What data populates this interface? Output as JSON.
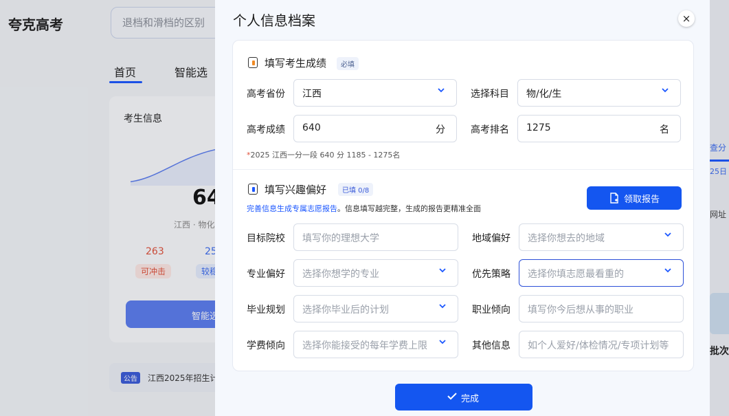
{
  "background": {
    "logo": "夸克高考",
    "search_text": "退档和滑档的区别",
    "tabs": [
      "首页",
      "智能选"
    ],
    "card_title": "考生信息",
    "score": "64",
    "province": "江西 · 物化",
    "counts": [
      "263",
      "25"
    ],
    "badges": [
      "可冲击",
      "较稳"
    ],
    "button": "智能选",
    "notice_tag": "公告",
    "notice_text": "江西2025年招生计",
    "right_tab": "查分",
    "right_year": "25日",
    "right_link": "网址",
    "right_bottom": "批次"
  },
  "modal": {
    "title": "个人信息档案",
    "close_icon": "×",
    "section1": {
      "title": "填写考生成绩",
      "tag": "必填",
      "province_label": "高考省份",
      "province_value": "江西",
      "subject_label": "选择科目",
      "subject_value": "物/化/生",
      "score_label": "高考成绩",
      "score_value": "640",
      "score_unit": "分",
      "rank_label": "高考排名",
      "rank_value": "1275",
      "rank_unit": "名",
      "note_star": "*",
      "note": "2025 江西一分一段 640 分 1185 - 1275名"
    },
    "section2": {
      "title": "填写兴趣偏好",
      "tag": "已填 0/8",
      "hint_link": "完善信息生成专属志愿报告",
      "hint_rest": "。信息填写越完整，生成的报告更精准全面",
      "report_button": "领取报告",
      "fields": [
        {
          "label": "目标院校",
          "placeholder": "填写你的理想大学"
        },
        {
          "label": "地域偏好",
          "placeholder": "选择你想去的地域"
        },
        {
          "label": "专业偏好",
          "placeholder": "选择你想学的专业"
        },
        {
          "label": "优先策略",
          "placeholder": "选择你填志愿最看重的"
        },
        {
          "label": "毕业规划",
          "placeholder": "选择你毕业后的计划"
        },
        {
          "label": "职业倾向",
          "placeholder": "填写你今后想从事的职业"
        },
        {
          "label": "学费倾向",
          "placeholder": "选择你能接受的每年学费上限"
        },
        {
          "label": "其他信息",
          "placeholder": "如个人爱好/体检情况/专项计划等"
        }
      ]
    },
    "done_button": "完成"
  }
}
